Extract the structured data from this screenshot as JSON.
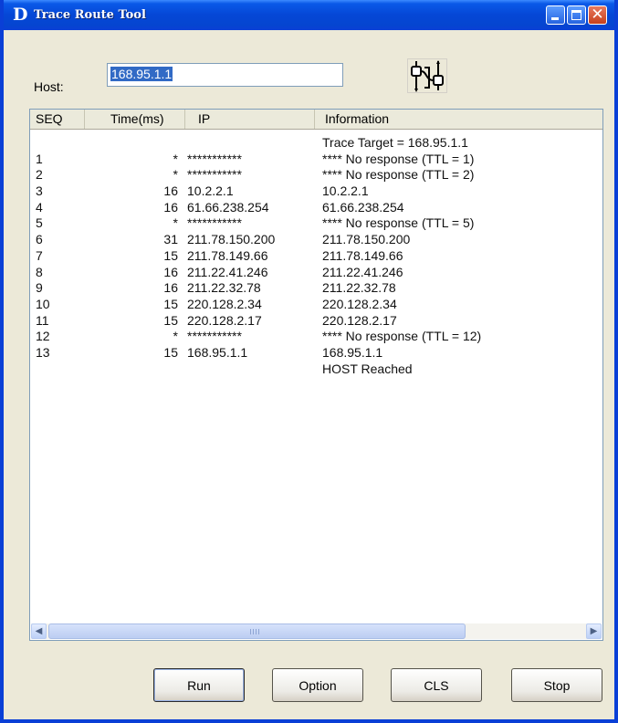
{
  "window": {
    "title": "Trace Route Tool",
    "logo_letter": "D",
    "controls": {
      "close_glyph": "✕"
    }
  },
  "host": {
    "label": "Host:",
    "value": "168.95.1.1"
  },
  "toolbar": {
    "icon": "trace-route-icon"
  },
  "table": {
    "columns": [
      "SEQ",
      "Time(ms)",
      "IP",
      "Information"
    ],
    "rows": [
      {
        "seq": "",
        "time": "",
        "ip": "",
        "info": "Trace Target = 168.95.1.1"
      },
      {
        "seq": "1",
        "time": "*",
        "ip": "***********",
        "info": "**** No response (TTL = 1)"
      },
      {
        "seq": "2",
        "time": "*",
        "ip": "***********",
        "info": "**** No response (TTL = 2)"
      },
      {
        "seq": "3",
        "time": "16",
        "ip": "10.2.2.1",
        "info": "10.2.2.1"
      },
      {
        "seq": "4",
        "time": "16",
        "ip": "61.66.238.254",
        "info": "61.66.238.254"
      },
      {
        "seq": "5",
        "time": "*",
        "ip": "***********",
        "info": "**** No response (TTL = 5)"
      },
      {
        "seq": "6",
        "time": "31",
        "ip": "211.78.150.200",
        "info": "211.78.150.200"
      },
      {
        "seq": "7",
        "time": "15",
        "ip": "211.78.149.66",
        "info": "211.78.149.66"
      },
      {
        "seq": "8",
        "time": "16",
        "ip": "211.22.41.246",
        "info": "211.22.41.246"
      },
      {
        "seq": "9",
        "time": "16",
        "ip": "211.22.32.78",
        "info": "211.22.32.78"
      },
      {
        "seq": "10",
        "time": "15",
        "ip": "220.128.2.34",
        "info": "220.128.2.34"
      },
      {
        "seq": "11",
        "time": "15",
        "ip": "220.128.2.17",
        "info": "220.128.2.17"
      },
      {
        "seq": "12",
        "time": "*",
        "ip": "***********",
        "info": "**** No response (TTL = 12)"
      },
      {
        "seq": "13",
        "time": "15",
        "ip": "168.95.1.1",
        "info": "168.95.1.1"
      },
      {
        "seq": "",
        "time": "",
        "ip": "",
        "info": "HOST Reached"
      }
    ]
  },
  "buttons": {
    "run": "Run",
    "option": "Option",
    "cls": "CLS",
    "stop": "Stop"
  },
  "colors": {
    "titlebar": "#0547d6",
    "selection": "#316ac5",
    "dialog_bg": "#ece9d8"
  }
}
